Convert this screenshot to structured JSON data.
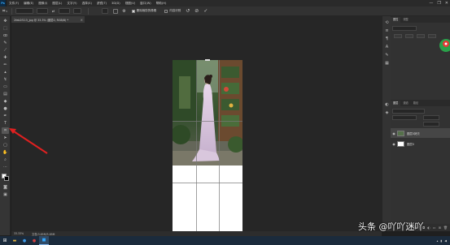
{
  "app": {
    "logo": "Ps",
    "menu": [
      "文件(F)",
      "编辑(E)",
      "图像(I)",
      "图层(L)",
      "文字(Y)",
      "选择(S)",
      "滤镜(T)",
      "3D(D)",
      "视图(V)",
      "窗口(W)",
      "帮助(H)"
    ],
    "window_controls": [
      "—",
      "❐",
      "✕"
    ]
  },
  "options_bar": {
    "tool_icon": "crop-icon",
    "delete_cropped_label": "删除裁剪的像素",
    "content_aware_label": "内容识别"
  },
  "document": {
    "tab_title": "2feb2f115_jpg @ 33.3% (图层0, RGB/8) *",
    "close": "×"
  },
  "toolbar": {
    "tools": [
      "move-icon",
      "marquee-icon",
      "lasso-icon",
      "quick-select-icon",
      "crop-icon",
      "eyedropper-icon",
      "healing-icon",
      "brush-icon",
      "stamp-icon",
      "history-brush-icon",
      "eraser-icon",
      "gradient-icon",
      "blur-icon",
      "dodge-icon",
      "pen-icon",
      "type-icon",
      "path-select-icon",
      "rectangle-icon",
      "hand-icon",
      "zoom-icon"
    ],
    "active_tool": "crop-icon"
  },
  "panels": {
    "top_tabs": [
      "属性",
      "调整"
    ],
    "layers_tabs": [
      "图层",
      "通道",
      "路径"
    ],
    "layers": [
      {
        "name": "图层0拷贝",
        "selected": true
      },
      {
        "name": "图层0",
        "selected": false
      }
    ]
  },
  "status": {
    "zoom": "33.33%",
    "doc_info": "文档:3.85M/3.85M"
  },
  "watermark": {
    "text": "头条 @吖吖迷吖"
  },
  "colors": {
    "accent": "#31a8ff",
    "annotation_arrow": "#e02020",
    "canvas_bg": "#262626"
  }
}
